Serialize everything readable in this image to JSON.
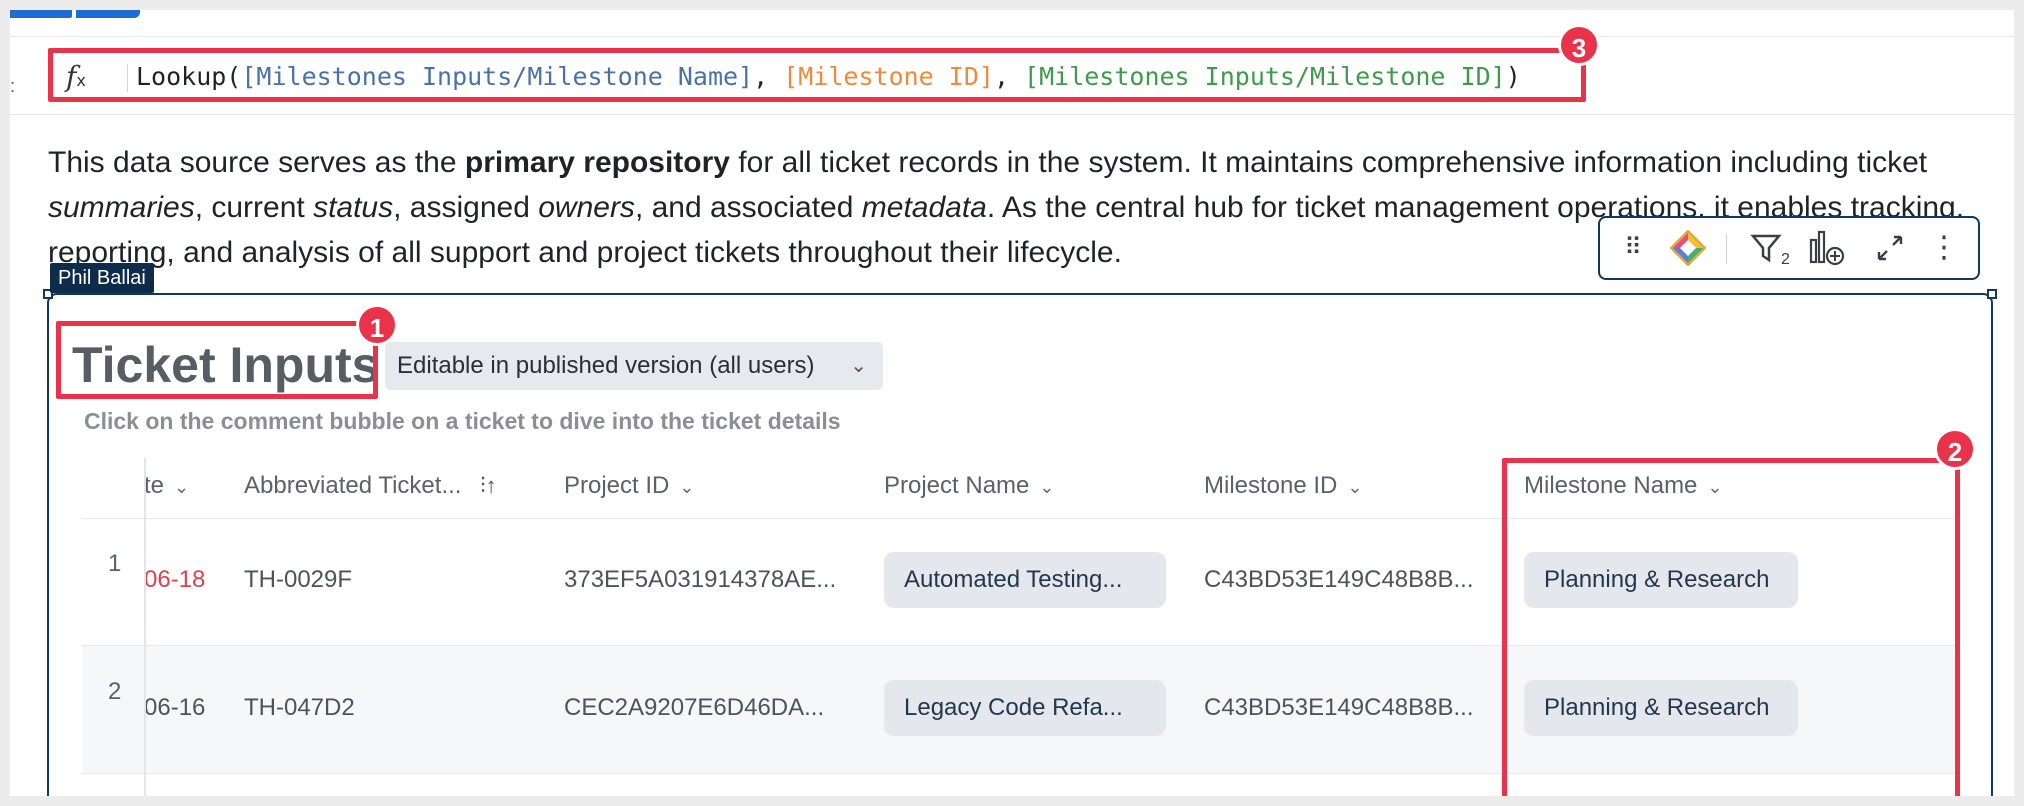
{
  "formula": {
    "function_open": "Lookup(",
    "arg1": "[Milestones Inputs/Milestone Name]",
    "sep1": ", ",
    "arg2": "[Milestone ID]",
    "sep2": ", ",
    "arg3": "[Milestones Inputs/Milestone ID]",
    "close": ")",
    "fx_glyph": "f",
    "fx_sub": "x"
  },
  "description": {
    "part1": "This data source serves as the ",
    "bold1": "primary repository",
    "part2": " for all ticket records in the system. It maintains comprehensive information including ticket ",
    "it1": "summaries",
    "part3": ", current ",
    "it2": "status",
    "part4": ", assigned ",
    "it3": "owners",
    "part5": ", and associated ",
    "it4": "metadata",
    "part6": ". As the central hub for ticket management operations, it enables tracking, reporting, and analysis of all support and project tickets throughout their lifecycle."
  },
  "collaborator": {
    "name": "Phil Ballai"
  },
  "toolbar": {
    "icons": [
      "drag-handle-icon",
      "ai-assistant-icon",
      "filter-icon",
      "add-chart-icon",
      "expand-icon",
      "more-icon"
    ],
    "filter_count": "2"
  },
  "element": {
    "title": "Ticket Inputs",
    "edit_mode": "Editable in published version (all users)",
    "subtitle": "Click on the comment bubble on a ticket to dive into the ticket details"
  },
  "annotations": {
    "title_badge": "1",
    "column_badge": "2",
    "formula_badge": "3"
  },
  "table": {
    "columns": [
      "te",
      "Abbreviated Ticket...",
      "Project ID",
      "Project Name",
      "Milestone ID",
      "Milestone Name"
    ],
    "rows": [
      {
        "num": "1",
        "date": "06-18",
        "ticket": "TH-0029F",
        "project_id": "373EF5A031914378AE...",
        "project_name": "Automated Testing...",
        "milestone_id": "C43BD53E149C48B8B...",
        "milestone_name": "Planning & Research"
      },
      {
        "num": "2",
        "date": "06-16",
        "ticket": "TH-047D2",
        "project_id": "CEC2A9207E6D46DA...",
        "project_name": "Legacy Code Refa...",
        "milestone_id": "C43BD53E149C48B8B...",
        "milestone_name": "Planning & Research"
      }
    ]
  },
  "colors": {
    "annotation": "#e8334a",
    "selection": "#12385f",
    "accent": "#1f6bd1"
  }
}
